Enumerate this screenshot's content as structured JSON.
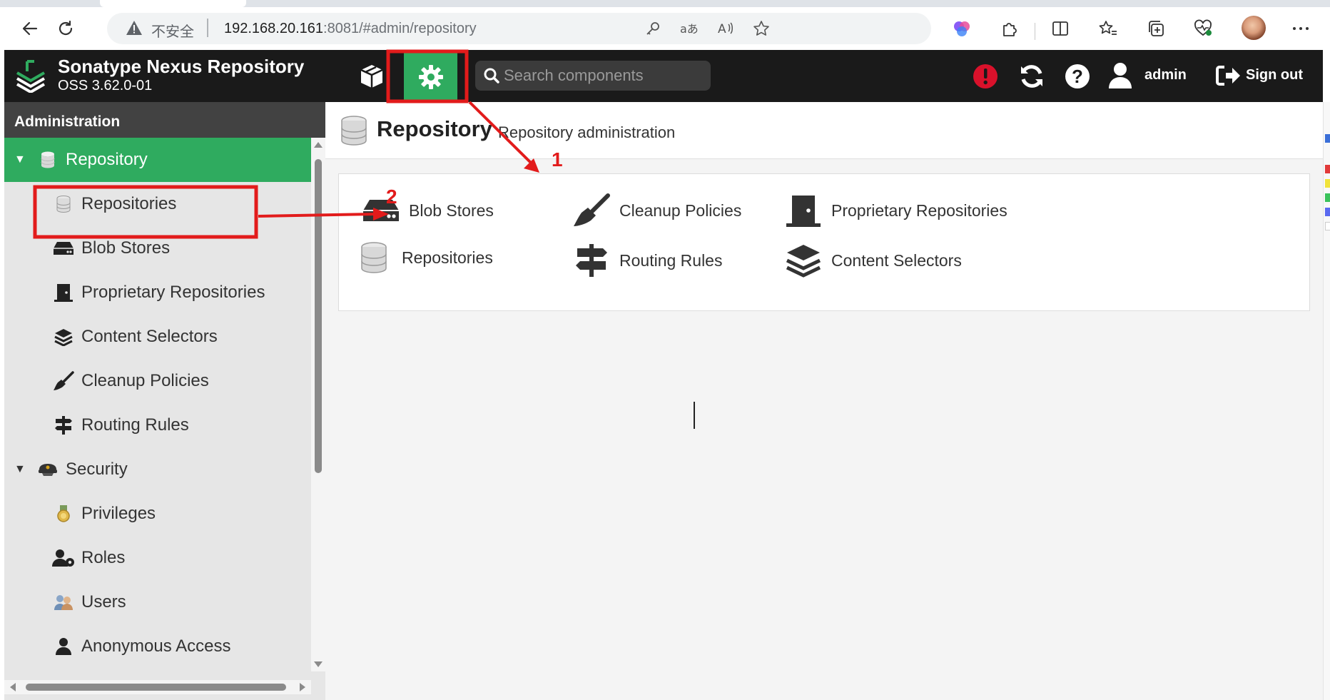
{
  "browser": {
    "security_label": "不安全",
    "url_host": "192.168.20.161",
    "url_rest": ":8081/#admin/repository",
    "icons": [
      "back-icon",
      "refresh-icon",
      "warning-icon",
      "key-icon",
      "translate-icon",
      "read-aloud-icon",
      "favorite-star-icon",
      "copilot-icon",
      "extensions-icon",
      "split-screen-icon",
      "favorites-icon",
      "collections-icon",
      "performance-icon",
      "profile-avatar",
      "more-icon"
    ]
  },
  "header": {
    "app_name": "Sonatype Nexus Repository",
    "version": "OSS 3.62.0-01",
    "search_placeholder": "Search components",
    "user_label": "admin",
    "signout_label": "Sign out",
    "accent_color": "#2fab5f",
    "alert_color": "#d9112b"
  },
  "sidebar": {
    "heading": "Administration",
    "items": [
      {
        "label": "Repository",
        "icon": "database-icon",
        "level": "group",
        "expanded": true,
        "active": true
      },
      {
        "label": "Repositories",
        "icon": "database-icon",
        "level": "child"
      },
      {
        "label": "Blob Stores",
        "icon": "hdd-icon",
        "level": "child"
      },
      {
        "label": "Proprietary Repositories",
        "icon": "door-icon",
        "level": "child"
      },
      {
        "label": "Content Selectors",
        "icon": "layers-icon",
        "level": "child"
      },
      {
        "label": "Cleanup Policies",
        "icon": "broom-icon",
        "level": "child"
      },
      {
        "label": "Routing Rules",
        "icon": "signpost-icon",
        "level": "child"
      },
      {
        "label": "Security",
        "icon": "police-hat-icon",
        "level": "group",
        "expanded": true
      },
      {
        "label": "Privileges",
        "icon": "medal-icon",
        "level": "child"
      },
      {
        "label": "Roles",
        "icon": "user-gear-icon",
        "level": "child"
      },
      {
        "label": "Users",
        "icon": "users-icon",
        "level": "child"
      },
      {
        "label": "Anonymous Access",
        "icon": "user-icon",
        "level": "child"
      }
    ]
  },
  "main": {
    "title": "Repository",
    "subtitle": "Repository administration",
    "tiles": [
      {
        "label": "Blob Stores",
        "icon": "hdd-icon"
      },
      {
        "label": "Cleanup Policies",
        "icon": "broom-icon"
      },
      {
        "label": "Proprietary Repositories",
        "icon": "door-icon"
      },
      {
        "label": "Repositories",
        "icon": "database-icon"
      },
      {
        "label": "Routing Rules",
        "icon": "signpost-icon"
      },
      {
        "label": "Content Selectors",
        "icon": "layers-icon"
      }
    ]
  },
  "annotations": {
    "step1": "1",
    "step2": "2",
    "color": "#e21b1b"
  }
}
